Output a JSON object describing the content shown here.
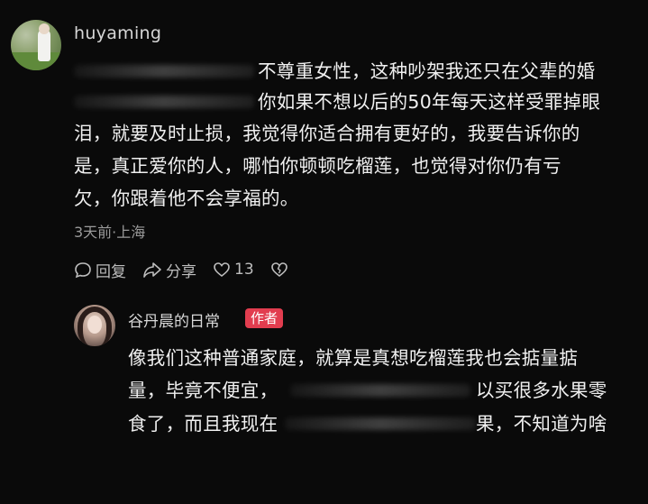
{
  "comment": {
    "username": "huyaming",
    "lines": [
      "不尊重女性，这种吵架我还只在父辈的婚",
      "你如果不想以后的50年每天这样受罪掉眼",
      "泪，就要及时止损，我觉得你适合拥有更好的，我要告诉你的",
      "是，真正爱你的人，哪怕你顿顿吃榴莲，也觉得对你仍有亏",
      "欠，你跟着他不会享福的。"
    ],
    "meta": "3天前·上海",
    "actions": {
      "reply_label": "回复",
      "share_label": "分享",
      "like_count": "13"
    },
    "icons": [
      "reply-icon",
      "share-icon",
      "heart-icon",
      "broken-heart-icon"
    ]
  },
  "reply": {
    "username": "谷丹晨的日常",
    "badge": "作者",
    "badge_color": "#e23d4f",
    "lines": [
      "像我们这种普通家庭，就算是真想吃榴莲我也会掂量掂",
      "量，毕竟不便宜，",
      "以买很多水果零",
      "食了，而且我现在",
      "果，不知道为啥"
    ]
  }
}
